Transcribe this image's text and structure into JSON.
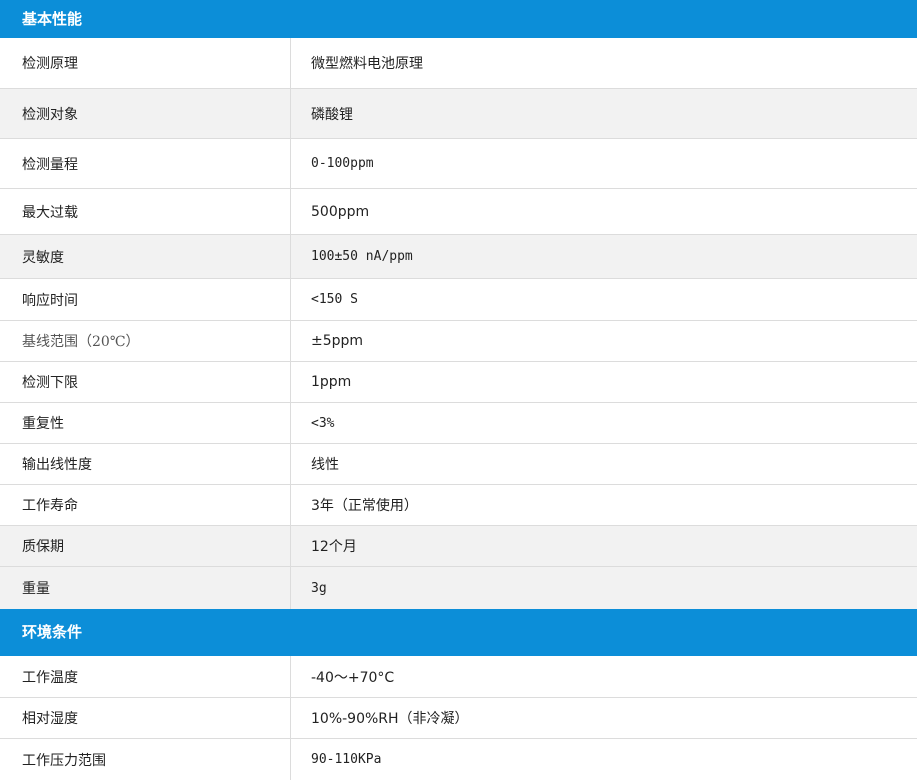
{
  "sections": [
    {
      "title": "基本性能",
      "rows": [
        {
          "label": "检测原理",
          "value": "微型燃料电池原理"
        },
        {
          "label": "检测对象",
          "value": "磷酸锂"
        },
        {
          "label": "检测量程",
          "value": "0-100ppm"
        },
        {
          "label": "最大过载",
          "value": "500ppm"
        },
        {
          "label": "灵敏度",
          "value": "100±50 nA/ppm"
        },
        {
          "label": "响应时间",
          "value": "<150 S"
        },
        {
          "label": "基线范围（20℃）",
          "value": "±5ppm"
        },
        {
          "label": "检测下限",
          "value": "1ppm"
        },
        {
          "label": "重复性",
          "value": "<3%"
        },
        {
          "label": "输出线性度",
          "value": "线性"
        },
        {
          "label": "工作寿命",
          "value": "3年（正常使用）"
        },
        {
          "label": "质保期",
          "value": "12个月"
        },
        {
          "label": "重量",
          "value": "3g"
        }
      ]
    },
    {
      "title": "环境条件",
      "rows": [
        {
          "label": "工作温度",
          "value": "-40～+70°C"
        },
        {
          "label": "相对湿度",
          "value": "10%-90%RH（非冷凝）"
        },
        {
          "label": "工作压力范围",
          "value": "90-110KPa"
        }
      ]
    }
  ]
}
